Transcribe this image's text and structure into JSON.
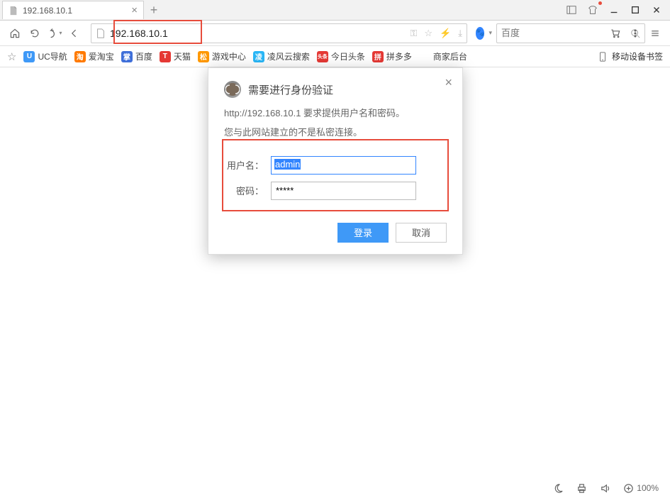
{
  "tab": {
    "title": "192.168.10.1"
  },
  "url": "192.168.10.1",
  "search": {
    "placeholder": "百度"
  },
  "bookmarks": [
    {
      "label": "UC导航",
      "color": "#3f99f7",
      "ico": "U"
    },
    {
      "label": "爱淘宝",
      "color": "#ff7a00",
      "ico": "淘"
    },
    {
      "label": "百度",
      "color": "#3f6fd9",
      "ico": "掌"
    },
    {
      "label": "天猫",
      "color": "#e53935",
      "ico": "T"
    },
    {
      "label": "游戏中心",
      "color": "#ff9800",
      "ico": "松"
    },
    {
      "label": "凌风云搜索",
      "color": "#29b6f6",
      "ico": "凌"
    },
    {
      "label": "今日头条",
      "color": "#e53935",
      "ico": "头条"
    },
    {
      "label": "拼多多",
      "color": "#e53935",
      "ico": "拼"
    },
    {
      "label": "商家后台",
      "color": "#ffffff",
      "ico": ""
    }
  ],
  "bm_right": {
    "label": "移动设备书签"
  },
  "dialog": {
    "title": "需要进行身份验证",
    "msg1": "http://192.168.10.1 要求提供用户名和密码。",
    "msg2": "您与此网站建立的不是私密连接。",
    "username_label": "用户名：",
    "password_label": "密码：",
    "username_value": "admin",
    "password_value": "*****",
    "login": "登录",
    "cancel": "取消"
  },
  "status": {
    "zoom": "100%"
  }
}
